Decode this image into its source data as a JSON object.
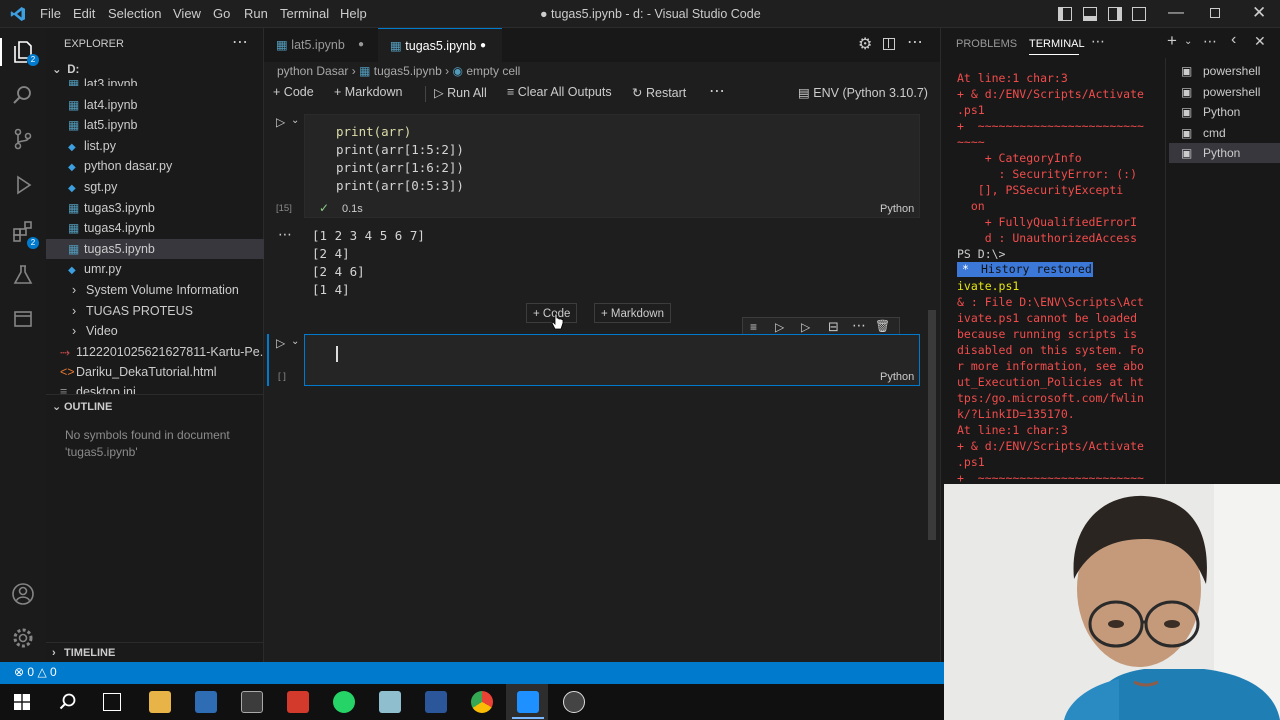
{
  "window": {
    "title": "● tugas5.ipynb - d: - Visual Studio Code",
    "menu": [
      "File",
      "Edit",
      "Selection",
      "View",
      "Go",
      "Run",
      "Terminal",
      "Help"
    ]
  },
  "sidebar": {
    "explorer_title": "EXPLORER",
    "root": "D:",
    "files": [
      {
        "name": "lat3.ipynb"
      },
      {
        "name": "lat4.ipynb"
      },
      {
        "name": "lat5.ipynb"
      },
      {
        "name": "list.py"
      },
      {
        "name": "python dasar.py"
      },
      {
        "name": "sgt.py"
      },
      {
        "name": "tugas3.ipynb"
      },
      {
        "name": "tugas4.ipynb"
      },
      {
        "name": "tugas5.ipynb"
      },
      {
        "name": "umr.py"
      }
    ],
    "folders": [
      "System Volume Information",
      "TUGAS PROTEUS",
      "Video"
    ],
    "other_files": [
      "112220102562162781​1-Kartu-Pe...",
      "Dariku_DekaTutorial.html",
      "desktop.ini"
    ],
    "outline_title": "OUTLINE",
    "outline_msg1": "No symbols found in document",
    "outline_msg2": "'tugas5.ipynb'",
    "timeline_title": "TIMELINE"
  },
  "editor": {
    "tabs": [
      {
        "label": "lat5.ipynb"
      },
      {
        "label": "tugas5.ipynb"
      }
    ],
    "breadcrumb": [
      "python Dasar",
      "tugas5.ipynb",
      "empty cell"
    ],
    "toolbar": {
      "code": "Code",
      "markdown": "Markdown",
      "run_all": "Run All",
      "clear": "Clear All Outputs",
      "restart": "Restart",
      "kernel": "ENV (Python 3.10.7)"
    },
    "cell1": {
      "lines": [
        "print(arr)",
        "print(arr[1:5:2])",
        "print(arr[1:6:2])",
        "print(arr[0:5:3])"
      ],
      "exec_count": "[15]",
      "time": "0.1s",
      "lang": "Python",
      "outputs": [
        "[1 2 3 4 5 6 7]",
        "[2 4]",
        "[2 4 6]",
        "[1 4]"
      ]
    },
    "insert": {
      "code": "Code",
      "markdown": "Markdown"
    },
    "cell2": {
      "exec_count": "[ ]",
      "lang": "Python"
    }
  },
  "panel": {
    "tabs": [
      "PROBLEMS",
      "TERMINAL"
    ],
    "terminal_lines": [
      "At line:1 char:3",
      "+ & d:/ENV/Scripts/Activate",
      ".ps1",
      "+  ~~~~~~~~~~~~~~~~~~~~~~~~",
      "~~~~",
      "    + CategoryInfo",
      "      : SecurityError: (:)",
      "   [], PSSecurityExcepti",
      "  on",
      "    + FullyQualifiedErrorI",
      "    d : UnauthorizedAccess"
    ],
    "prompt": "PS D:\\>",
    "history": "History restored",
    "after_lines": [
      "ivate.ps1",
      "& : File D:\\ENV\\Scripts\\Act",
      "ivate.ps1 cannot be loaded",
      "because running scripts is",
      "disabled on this system. Fo",
      "r more information, see abo",
      "ut_Execution_Policies at ht",
      "tps:/go.microsoft.com/fwlin",
      "k/?LinkID=135170.",
      "At line:1 char:3",
      "+ & d:/ENV/Scripts/Activate",
      ".ps1",
      "+  ~~~~~~~~~~~~~~~~~~~~~~~~"
    ],
    "shells": [
      "powershell",
      "powershell",
      "Python",
      "cmd",
      "Python"
    ]
  },
  "status": {
    "errors": "0",
    "warnings": "0"
  },
  "colors": {
    "accent": "#007acc",
    "error_text": "#f14c4c",
    "highlight": "#264f78"
  }
}
